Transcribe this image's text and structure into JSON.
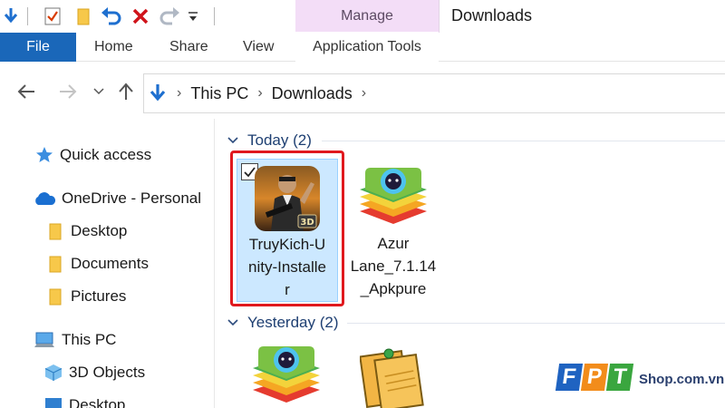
{
  "window": {
    "title": "Downloads"
  },
  "ribbon": {
    "contextual_header": "Manage",
    "tabs": {
      "file": "File",
      "home": "Home",
      "share": "Share",
      "view": "View",
      "app_tools": "Application Tools"
    }
  },
  "address": {
    "crumbs": [
      "This PC",
      "Downloads"
    ]
  },
  "nav_pane": {
    "items": [
      {
        "label": "Quick access",
        "icon": "star-icon"
      },
      {
        "label": "OneDrive - Personal",
        "icon": "cloud-icon"
      },
      {
        "label": "Desktop",
        "icon": "folder-icon"
      },
      {
        "label": "Documents",
        "icon": "folder-icon"
      },
      {
        "label": "Pictures",
        "icon": "folder-icon"
      },
      {
        "label": "This PC",
        "icon": "computer-icon"
      },
      {
        "label": "3D Objects",
        "icon": "cube-icon"
      },
      {
        "label": "Desktop",
        "icon": "desktop-icon"
      }
    ]
  },
  "content": {
    "groups": [
      {
        "label": "Today (2)",
        "files": [
          {
            "name_lines": [
              "TruyKich-U",
              "nity-Installe",
              "r"
            ],
            "selected": true,
            "icon": "game-installer-icon"
          },
          {
            "name_lines": [
              "Azur",
              "Lane_7.1.14",
              "_Apkpure"
            ],
            "selected": false,
            "icon": "bluestacks-icon"
          }
        ]
      },
      {
        "label": "Yesterday (2)",
        "files": [
          {
            "icon": "bluestacks-icon"
          },
          {
            "icon": "sticky-notes-icon"
          }
        ]
      }
    ]
  },
  "watermark": {
    "brand": "FPT",
    "suffix": "Shop.com.vn"
  },
  "colors": {
    "file_tab": "#1a67b9",
    "contextual": "#f3ddf7",
    "selection": "#cce8ff",
    "highlight": "#e0191e",
    "group_label": "#1e3f72"
  }
}
